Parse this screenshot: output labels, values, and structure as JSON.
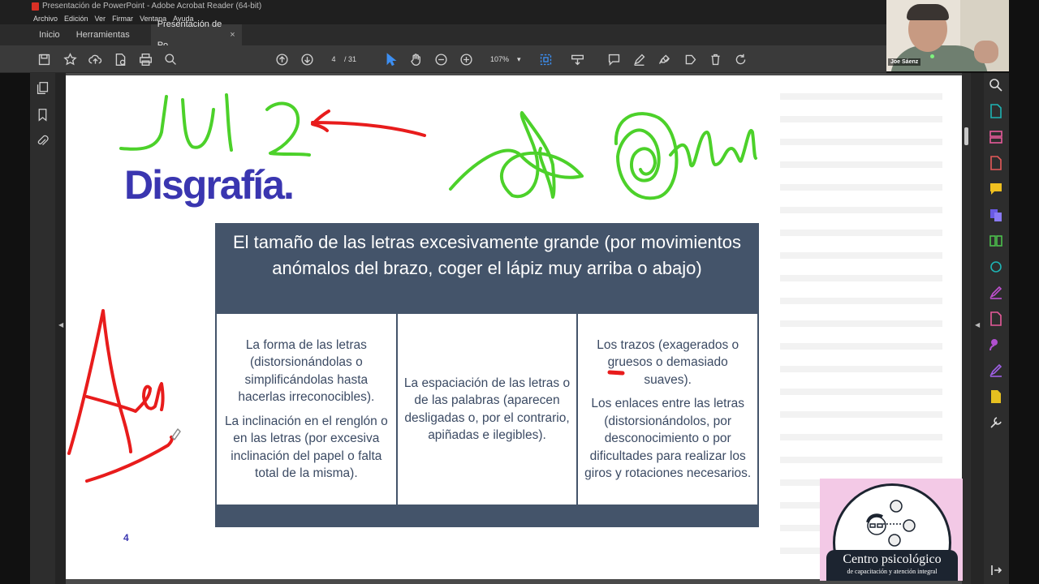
{
  "window": {
    "title": "Presentación de PowerPoint - Adobe Acrobat Reader (64-bit)"
  },
  "menu": [
    "Archivo",
    "Edición",
    "Ver",
    "Firmar",
    "Ventana",
    "Ayuda"
  ],
  "tabs": {
    "home": "Inicio",
    "tools": "Herramientas",
    "document": "Presentación de Po...",
    "close_glyph": "×"
  },
  "toolbar": {
    "page_current": "4",
    "page_total": "/ 31",
    "zoom": "107%",
    "zoom_caret": "▾",
    "icons": [
      "save-icon",
      "star-icon",
      "cloud-upload-icon",
      "file-info-icon",
      "print-icon",
      "search-zoom-icon",
      "page-up-icon",
      "page-down-icon",
      "select-cursor-icon",
      "hand-icon",
      "zoom-out-icon",
      "zoom-in-icon",
      "fit-page-icon",
      "read-mode-icon",
      "comment-icon",
      "highlight-pen-icon",
      "sign-icon",
      "stamp-icon",
      "delete-icon",
      "rotate-icon"
    ]
  },
  "webcam": {
    "name": "Joe Sáenz"
  },
  "slide": {
    "title": "Disgrafía.",
    "table_header": "El tamaño de las letras excesivamente grande (por movimientos anómalos del brazo, coger el lápiz muy arriba o abajo)",
    "col1": {
      "p1": "La forma de las letras (distorsionándolas o simplificándolas hasta hacerlas irreconocibles).",
      "p2": "La inclinación en el renglón o en las letras (por excesiva inclinación del papel o falta total de la misma)."
    },
    "col2": {
      "p1": "La espaciación de las letras o de las palabras (aparecen desligadas o, por el contrario, apiñadas e ilegibles)."
    },
    "col3": {
      "p1": "Los trazos (exagerados o gruesos o demasiado suaves).",
      "p2": "Los enlaces entre las letras (distorsionándolos, por desconocimiento o por dificultades para realizar los giros y rotaciones necesarios."
    },
    "page_number": "4"
  },
  "logo": {
    "line1": "Centro psicológico",
    "line2": "de capacitación y atención integral"
  },
  "colors": {
    "title_blue": "#3a36b0",
    "table_header_bg": "#44546a",
    "cell_text": "#3b4a63",
    "ink_green": "#4cd12a",
    "ink_red": "#e81c1c"
  }
}
